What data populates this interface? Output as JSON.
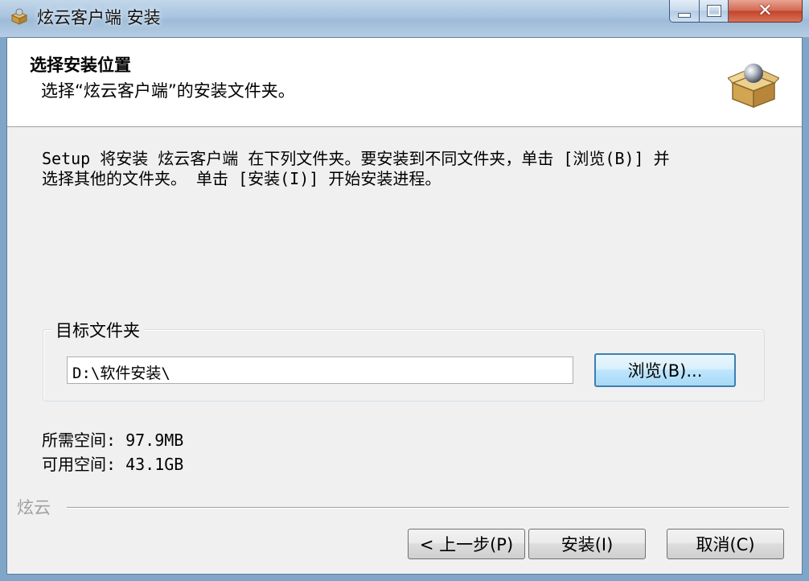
{
  "window": {
    "title": "炫云客户端 安装",
    "icon": "installer-box-icon",
    "controls": {
      "minimize": "minimize-icon",
      "maximize": "maximize-icon",
      "close": "close-icon"
    }
  },
  "header": {
    "title": "选择安装位置",
    "subtitle": "选择“炫云客户端”的安装文件夹。",
    "icon": "installer-box-icon"
  },
  "intro": {
    "line1": "Setup 将安装 炫云客户端 在下列文件夹。要安装到不同文件夹，单击 [浏览(B)] 并",
    "line2": "选择其他的文件夹。 单击 [安装(I)] 开始安装进程。"
  },
  "destination": {
    "group_label": "目标文件夹",
    "path": "D:\\软件安装\\",
    "browse_label": "浏览(B)..."
  },
  "space": {
    "required": "所需空间: 97.9MB",
    "available": "可用空间: 43.1GB"
  },
  "footer": {
    "brand": "炫云",
    "back_label": "< 上一步(P)",
    "install_label": "安装(I)",
    "cancel_label": "取消(C)"
  }
}
